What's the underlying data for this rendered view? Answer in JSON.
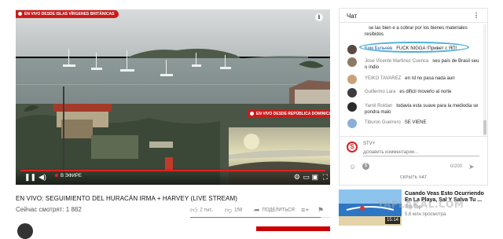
{
  "player": {
    "live_badge_main": "EN VIVO DESDE ISLAS VÍRGENES BRITÁNICAS",
    "live_badge_inset": "EN VIVO DESDE REPÚBLICA DOMINICANA",
    "live_label": "В ЭФИРЕ",
    "info_glyph": "i",
    "accent_color": "#e02020"
  },
  "video": {
    "title": "EN VIVO: SEGUIMIENTO DEL HURACÁN IRMA + HARVEY (LIVE STREAM)",
    "views": "Сейчас смотрят: 1 882",
    "like_count": "2 тыс.",
    "dislike_count": "158",
    "share_label": "ПОДЕЛИТЬСЯ",
    "like_ratio": 0.93
  },
  "chat": {
    "title": "Чат",
    "messages": [
      {
        "author": "",
        "text": "se las bien e a cobrar por los bienes materiales resibidos",
        "avatar_color": "#ffffff"
      },
      {
        "author": "Ким Бульчев",
        "text": "FUCK NIGGA !Привет с ЯП!",
        "avatar_color": "#5a4a44"
      },
      {
        "author": "Jose Vicente Martinez Cuenca",
        "text": "seu país de Brasil seu o índio",
        "avatar_color": "#8a7a66"
      },
      {
        "author": "YEIKO TAVAREZ",
        "text": "en rd no pasa nada aun",
        "avatar_color": "#c9a27a"
      },
      {
        "author": "Guillermo Lara",
        "text": "es dificil moverlo al norte",
        "avatar_color": "#3c3c3c"
      },
      {
        "author": "Yamil Roldan",
        "text": "todavia esta suave para la mediodia se pondra malo",
        "avatar_color": "#2b2b2b"
      },
      {
        "author": "Tiburon Guerrero",
        "text": "SE VIENE",
        "avatar_color": "#8ab0d6"
      }
    ],
    "composer": {
      "avatar_letter": "S",
      "name": "STV+",
      "placeholder": "Добавить комментарий...",
      "char_count": "0/200"
    },
    "hide_label": "СКРЫТЬ ЧАТ",
    "highlight_color": "#4ab0d8"
  },
  "recommendation": {
    "title": "Cuando Veas Esto Ocurriendo En La Playa, Sal Y Salva Tu ...",
    "channel": "Top Top",
    "views": "5,6 млн просмотра",
    "duration": "15:14"
  },
  "watermark": "YAPLAKAL.COM"
}
